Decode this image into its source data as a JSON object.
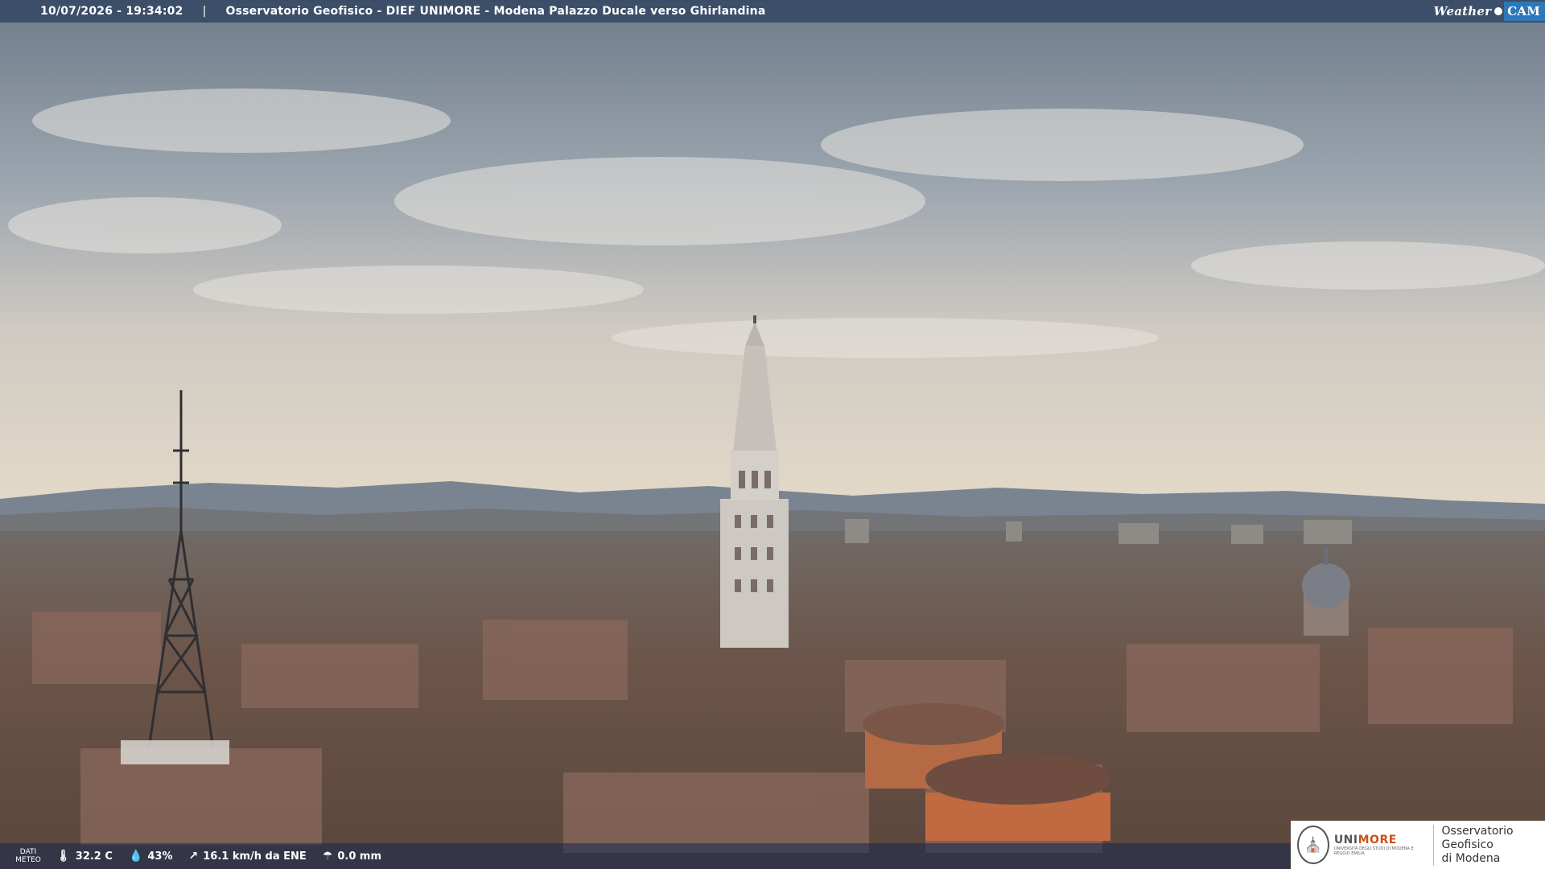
{
  "topbar": {
    "timestamp": "10/07/2026 - 19:34:02",
    "separator": "|",
    "title": "Osservatorio Geofisico - DIEF UNIMORE - Modena Palazzo Ducale verso Ghirlandina",
    "logo_weather": "Weather",
    "logo_cam": "CAM"
  },
  "weather": {
    "label_line1": "DATI",
    "label_line2": "METEO",
    "temperature": "32.2 C",
    "humidity": "43%",
    "wind": "16.1 km/h da ENE",
    "rain": "0.0 mm",
    "icons": [
      "thermometer-icon",
      "humidity-drop-icon",
      "wind-icon",
      "rain-gauge-icon"
    ]
  },
  "logo": {
    "brand_prefix": "UNI",
    "brand_suffix": "MORE",
    "university": "UNIVERSITÀ DEGLI STUDI DI MODENA E REGGIO EMILIA",
    "observatory_line1": "Osservatorio Geofisico",
    "observatory_line2": "di Modena"
  },
  "colors": {
    "sky_top": "#7d8894",
    "sky_horizon": "#d9d1c4",
    "roofs": "#6b5245",
    "accent_orange": "#c8511b",
    "weathercam_blue": "#2d78b8"
  }
}
